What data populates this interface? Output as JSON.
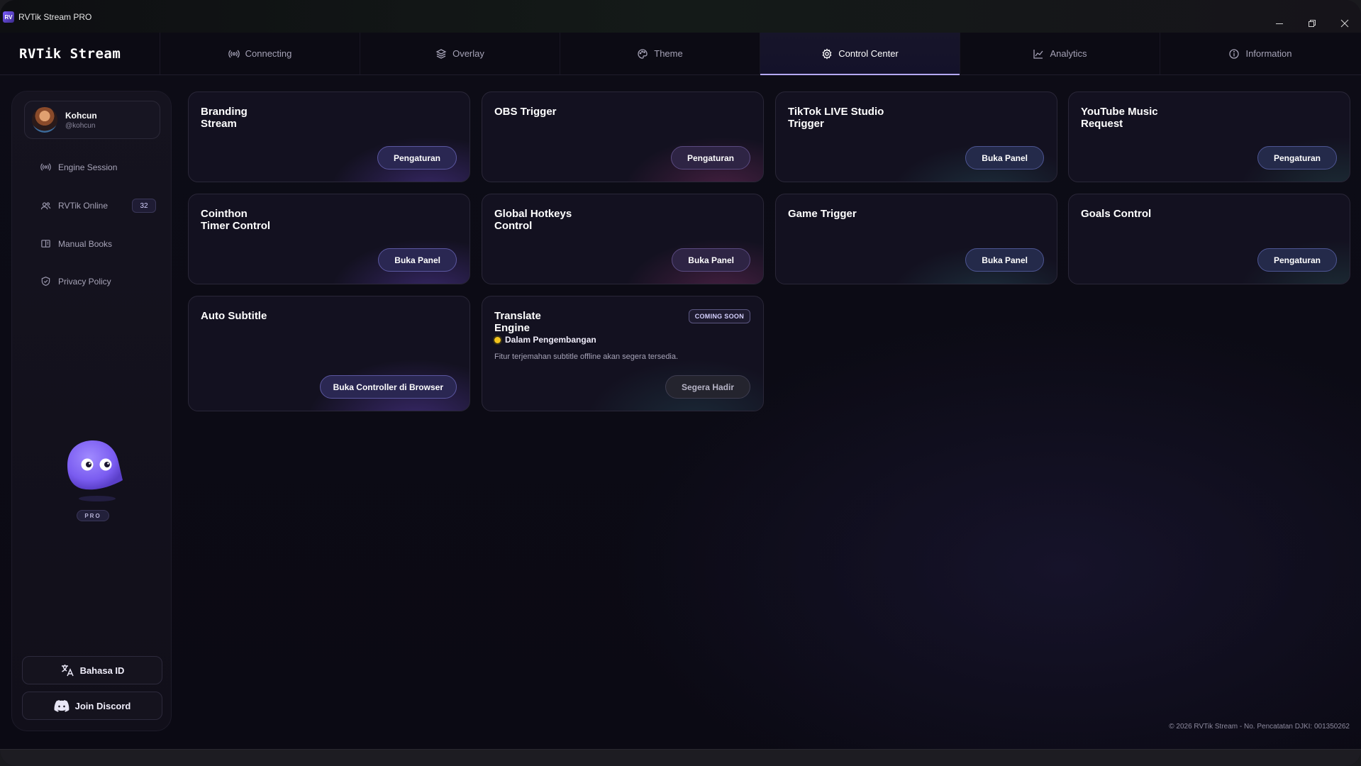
{
  "window": {
    "title": "RVTik Stream PRO",
    "app_icon_text": "RV"
  },
  "nav": {
    "brand": "RVTik Stream",
    "tabs": [
      {
        "label": "Connecting",
        "icon": "broadcast-icon"
      },
      {
        "label": "Overlay",
        "icon": "layers-icon"
      },
      {
        "label": "Theme",
        "icon": "palette-icon"
      },
      {
        "label": "Control Center",
        "icon": "gear-icon",
        "active": true
      },
      {
        "label": "Analytics",
        "icon": "chart-icon"
      },
      {
        "label": "Information",
        "icon": "info-icon"
      }
    ]
  },
  "sidebar": {
    "profile": {
      "name": "Kohcun",
      "handle": "@kohcun"
    },
    "items": [
      {
        "label": "Engine Session",
        "icon": "broadcast-icon"
      },
      {
        "label": "RVTik Online",
        "icon": "users-icon",
        "badge": "32"
      },
      {
        "label": "Manual Books",
        "icon": "book-icon"
      },
      {
        "label": "Privacy Policy",
        "icon": "shield-icon"
      }
    ],
    "pro_tag": "PRO",
    "language_button": "Bahasa ID",
    "discord_button": "Join Discord"
  },
  "cards": [
    {
      "title": "Branding\nStream",
      "button": "Pengaturan"
    },
    {
      "title": "OBS Trigger",
      "button": "Pengaturan"
    },
    {
      "title": "TikTok LIVE Studio\nTrigger",
      "button": "Buka Panel"
    },
    {
      "title": "YouTube Music\nRequest",
      "button": "Pengaturan"
    },
    {
      "title": "Cointhon\nTimer Control",
      "button": "Buka Panel"
    },
    {
      "title": "Global Hotkeys\nControl",
      "button": "Buka Panel"
    },
    {
      "title": "Game Trigger",
      "button": "Buka Panel"
    },
    {
      "title": "Goals Control",
      "button": "Pengaturan"
    },
    {
      "title": "Auto Subtitle",
      "button": "Buka Controller di Browser"
    },
    {
      "title": "Translate\nEngine",
      "badge": "COMING SOON",
      "status": "Dalam Pengembangan",
      "description": "Fitur terjemahan subtitle offline akan segera tersedia.",
      "button": "Segera Hadir"
    }
  ],
  "footer": "© 2026 RVTik Stream - No. Pencatatan DJKI: 001350262"
}
